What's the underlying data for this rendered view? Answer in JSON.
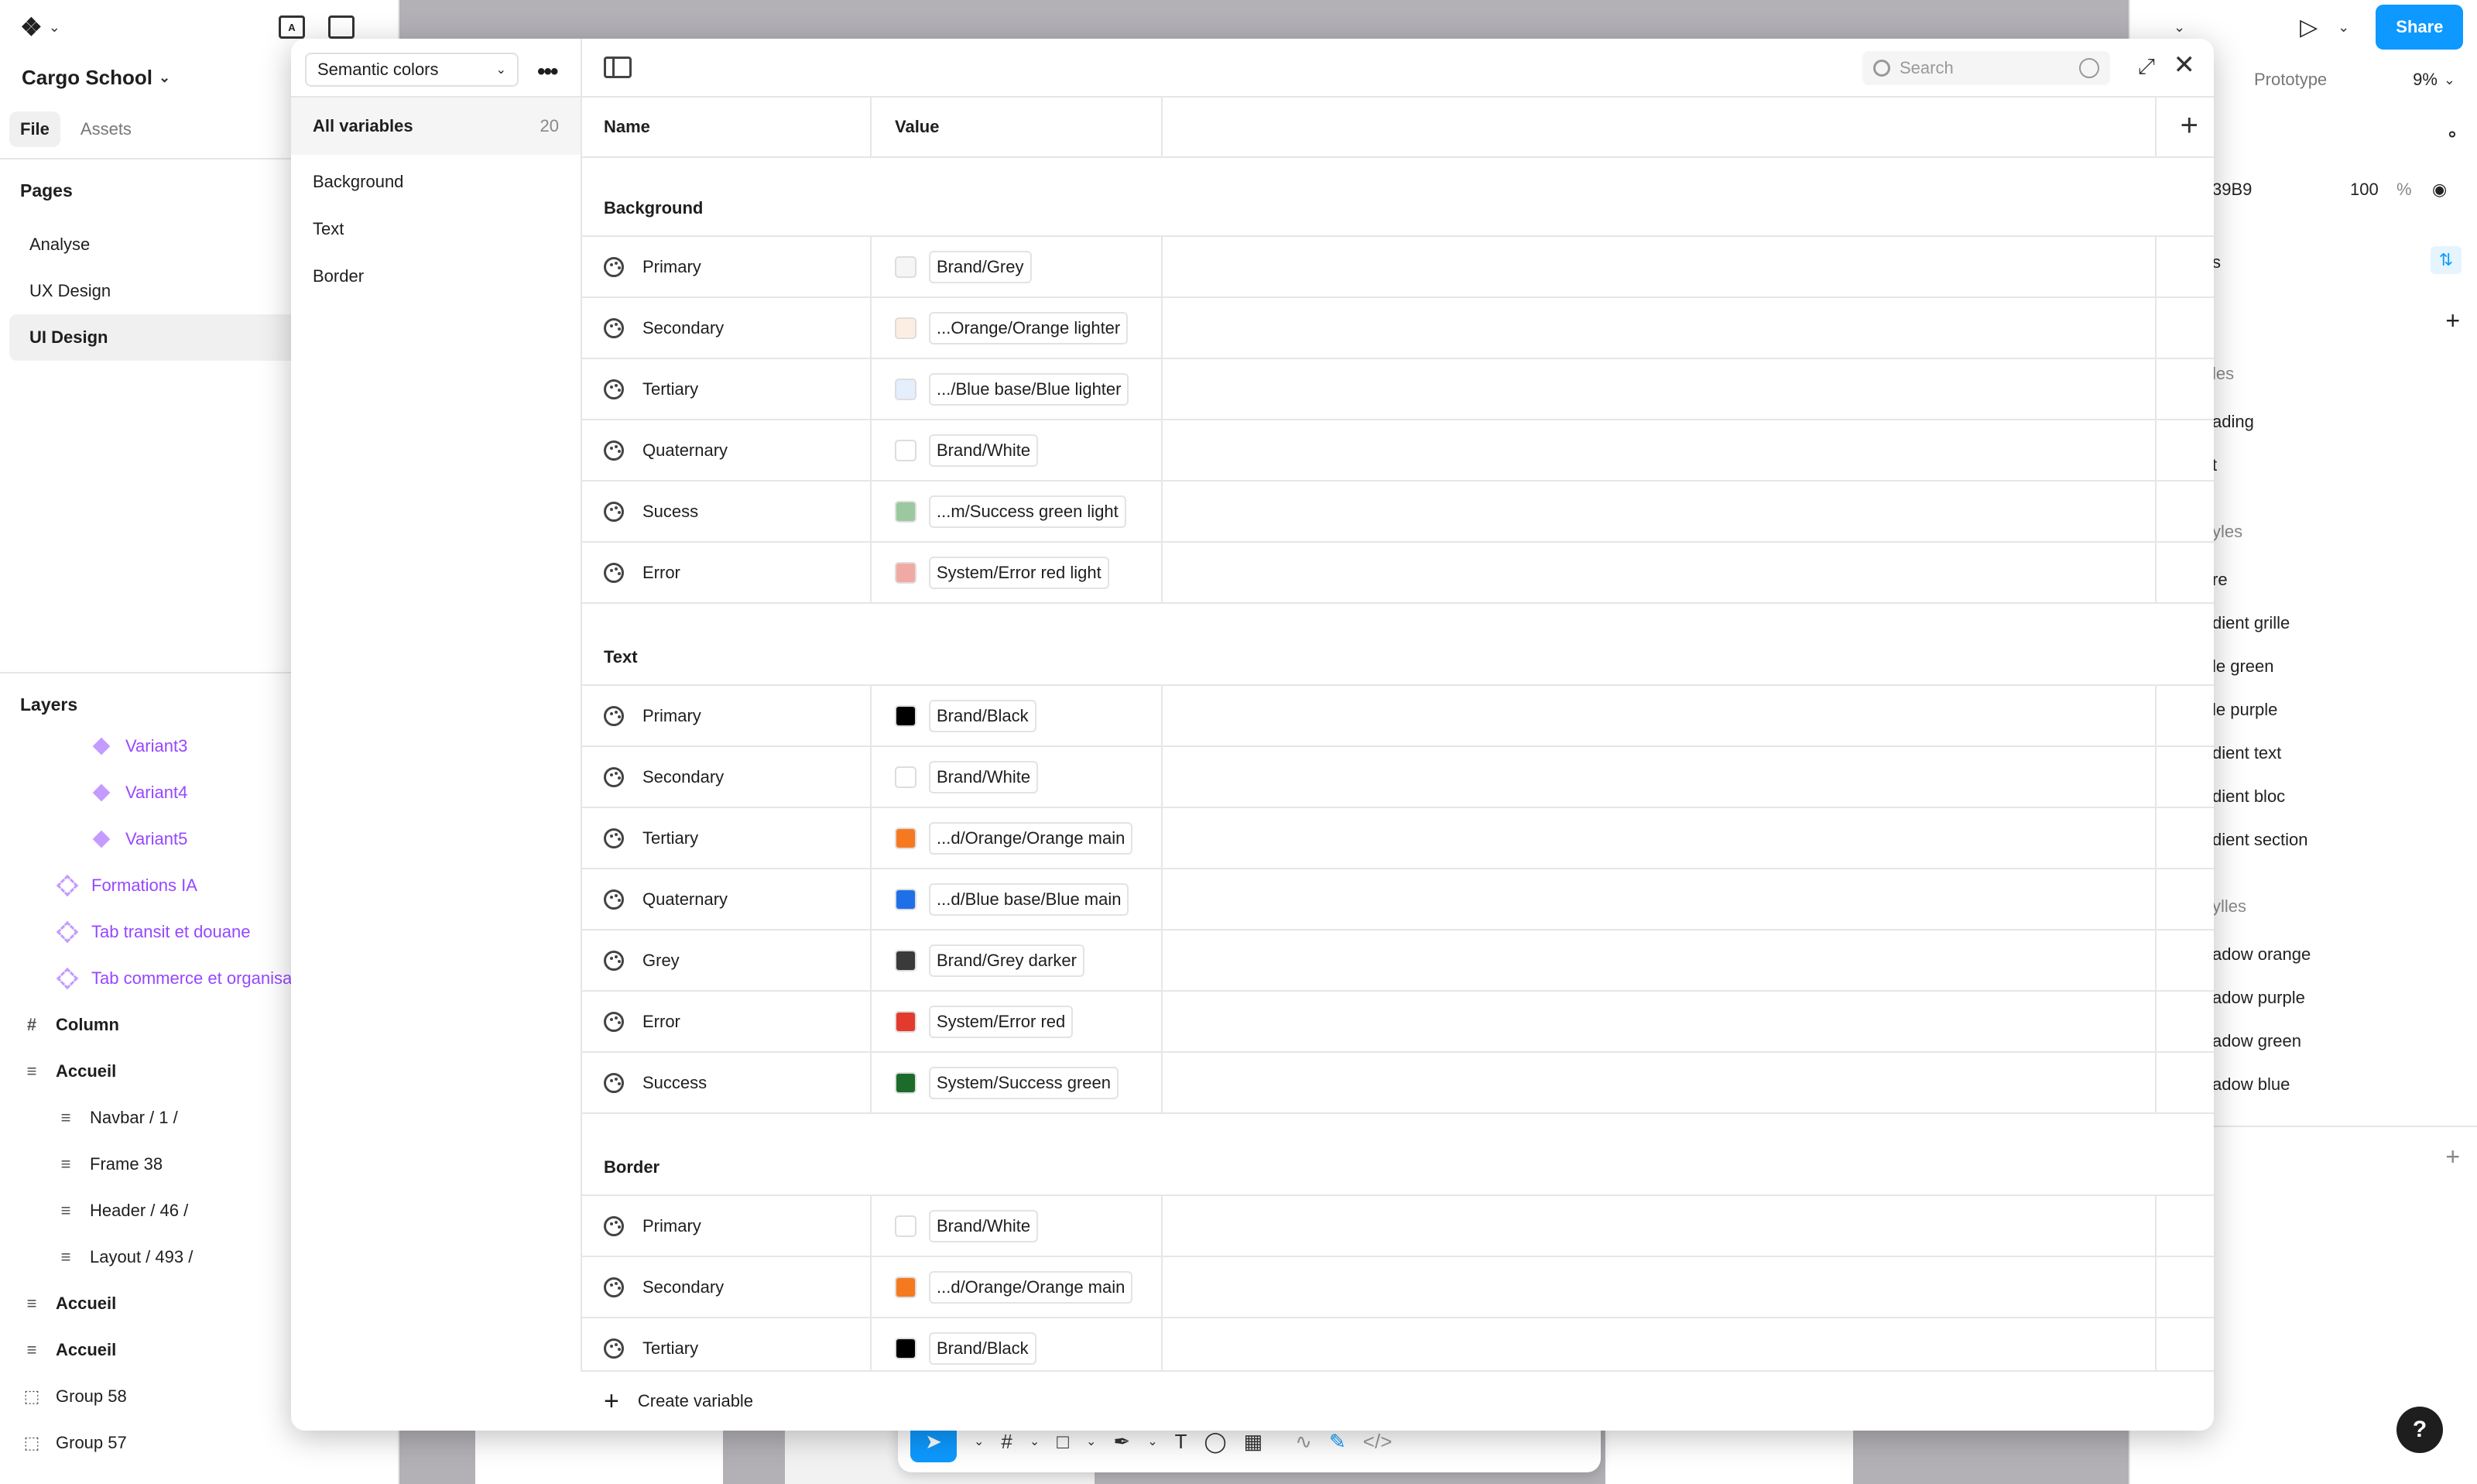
{
  "app": {
    "project_name": "Cargo School",
    "file_tabs": [
      "File",
      "Assets"
    ],
    "active_file_tab": "File"
  },
  "pages": {
    "heading": "Pages",
    "items": [
      "Analyse",
      "UX Design",
      "UI Design"
    ],
    "selected": "UI Design"
  },
  "layers": {
    "heading": "Layers",
    "items": [
      {
        "label": "Variant3",
        "type": "variant"
      },
      {
        "label": "Variant4",
        "type": "variant"
      },
      {
        "label": "Variant5",
        "type": "variant"
      },
      {
        "label": "Formations IA",
        "type": "component-set"
      },
      {
        "label": "Tab transit et douane",
        "type": "component-set"
      },
      {
        "label": "Tab commerce et organisa",
        "type": "component-set"
      },
      {
        "label": "Column",
        "type": "frame"
      },
      {
        "label": "Accueil",
        "type": "autolayout"
      },
      {
        "label": "Navbar / 1 /",
        "type": "autolayout-child"
      },
      {
        "label": "Frame 38",
        "type": "autolayout-child"
      },
      {
        "label": "Header / 46 /",
        "type": "autolayout-child"
      },
      {
        "label": "Layout / 493 /",
        "type": "autolayout-child"
      },
      {
        "label": "Accueil",
        "type": "autolayout"
      },
      {
        "label": "Accueil",
        "type": "autolayout"
      },
      {
        "label": "Group 58",
        "type": "group"
      },
      {
        "label": "Group 57",
        "type": "group"
      }
    ]
  },
  "right_panel": {
    "share_label": "Share",
    "prototype_tab": "Prototype",
    "zoom": "9%",
    "fill_hex": "39B9",
    "opacity": "100",
    "opacity_unit": "%",
    "section_label": "s",
    "styles": [
      "les",
      "ading",
      "t",
      "yles",
      "re",
      "dient grille",
      "le green",
      "le purple",
      "dient text",
      "dient bloc",
      "dient section",
      "ylles",
      "adow orange",
      "adow purple",
      "adow green",
      "adow blue"
    ]
  },
  "modal": {
    "collection": "Semantic colors",
    "all_variables_label": "All variables",
    "all_variables_count": "20",
    "groups": [
      "Background",
      "Text",
      "Border"
    ],
    "search_placeholder": "Search",
    "columns": {
      "name": "Name",
      "value": "Value"
    },
    "create_label": "Create variable",
    "sections": [
      {
        "title": "Background",
        "rows": [
          {
            "name": "Primary",
            "value": "Brand/Grey",
            "color": "#f5f5f5"
          },
          {
            "name": "Secondary",
            "value": "...Orange/Orange lighter",
            "color": "#fdeee4"
          },
          {
            "name": "Tertiary",
            "value": ".../Blue base/Blue lighter",
            "color": "#e4eefc"
          },
          {
            "name": "Quaternary",
            "value": "Brand/White",
            "color": "#ffffff"
          },
          {
            "name": "Sucess",
            "value": "...m/Success green light",
            "color": "#9cc89f"
          },
          {
            "name": "Error",
            "value": "System/Error red light",
            "color": "#f1aaa3"
          }
        ]
      },
      {
        "title": "Text",
        "rows": [
          {
            "name": "Primary",
            "value": "Brand/Black",
            "color": "#000000"
          },
          {
            "name": "Secondary",
            "value": "Brand/White",
            "color": "#ffffff"
          },
          {
            "name": "Tertiary",
            "value": "...d/Orange/Orange main",
            "color": "#f57a1f"
          },
          {
            "name": "Quaternary",
            "value": "...d/Blue base/Blue main",
            "color": "#1f6fe8"
          },
          {
            "name": "Grey",
            "value": "Brand/Grey darker",
            "color": "#3a3a3a"
          },
          {
            "name": "Error",
            "value": "System/Error red",
            "color": "#e23b2e"
          },
          {
            "name": "Success",
            "value": "System/Success green",
            "color": "#1c6b2a"
          }
        ]
      },
      {
        "title": "Border",
        "rows": [
          {
            "name": "Primary",
            "value": "Brand/White",
            "color": "#ffffff"
          },
          {
            "name": "Secondary",
            "value": "...d/Orange/Orange main",
            "color": "#f57a1f"
          },
          {
            "name": "Tertiary",
            "value": "Brand/Black",
            "color": "#000000"
          }
        ]
      }
    ]
  },
  "icons": {
    "figma_menu": "figma-logo-icon",
    "variable_row": "palette-icon"
  }
}
